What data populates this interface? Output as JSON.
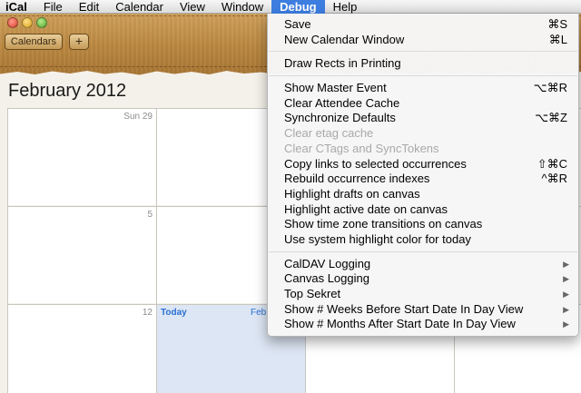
{
  "menubar": {
    "app": "iCal",
    "items": [
      "File",
      "Edit",
      "Calendar",
      "View",
      "Window",
      "Debug",
      "Help"
    ],
    "active": "Debug"
  },
  "toolbar": {
    "calendars_label": "Calendars",
    "add_label": "+"
  },
  "calendar": {
    "month_title": "February 2012",
    "day_labels": [
      "Sun 29",
      "5",
      "12"
    ],
    "today_label": "Today",
    "today_month": "Feb"
  },
  "debug_menu": {
    "groups": [
      [
        {
          "label": "Save",
          "shortcut": "⌘S"
        },
        {
          "label": "New Calendar Window",
          "shortcut": "⌘L"
        }
      ],
      [
        {
          "label": "Draw Rects in Printing"
        }
      ],
      [
        {
          "label": "Show Master Event",
          "shortcut": "⌥⌘R"
        },
        {
          "label": "Clear Attendee Cache"
        },
        {
          "label": "Synchronize Defaults",
          "shortcut": "⌥⌘Z"
        },
        {
          "label": "Clear etag cache",
          "disabled": true
        },
        {
          "label": "Clear CTags and SyncTokens",
          "disabled": true
        },
        {
          "label": "Copy links to selected occurrences",
          "shortcut": "⇧⌘C"
        },
        {
          "label": "Rebuild occurrence indexes",
          "shortcut": "^⌘R"
        },
        {
          "label": "Highlight drafts on canvas"
        },
        {
          "label": "Highlight active date on canvas"
        },
        {
          "label": "Show time zone transitions on canvas"
        },
        {
          "label": "Use system highlight color for today"
        }
      ],
      [
        {
          "label": "CalDAV Logging",
          "submenu": true
        },
        {
          "label": "Canvas Logging",
          "submenu": true
        },
        {
          "label": "Top Sekret",
          "submenu": true
        },
        {
          "label": "Show # Weeks Before Start Date In Day View",
          "submenu": true
        },
        {
          "label": "Show # Months After Start Date In Day View",
          "submenu": true
        }
      ]
    ]
  },
  "colors": {
    "menu_highlight": "#3d7ee0",
    "today_blue": "#2a6fd1",
    "leather": "#b98740"
  },
  "icons": {
    "close": "close-button-icon",
    "minimize": "minimize-button-icon",
    "zoom": "zoom-button-icon",
    "submenu": "submenu-arrow-icon"
  }
}
